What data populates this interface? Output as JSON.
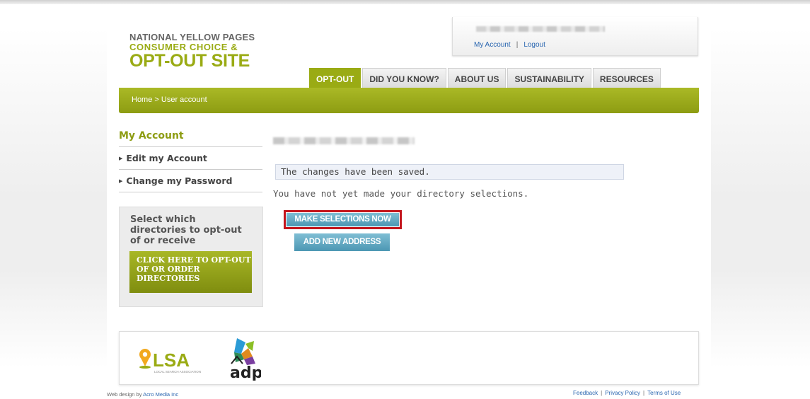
{
  "logo": {
    "line1": "NATIONAL YELLOW PAGES",
    "line2": "CONSUMER CHOICE &",
    "line3": "OPT-OUT SITE"
  },
  "account_bar": {
    "my_account": "My Account",
    "logout": "Logout"
  },
  "tabs": [
    "OPT-OUT",
    "DID YOU KNOW?",
    "ABOUT US",
    "SUSTAINABILITY",
    "RESOURCES"
  ],
  "breadcrumb": "Home > User account",
  "sidebar": {
    "title": "My Account",
    "items": [
      "Edit my Account",
      "Change my Password"
    ],
    "promo_text": "Select which directories to opt-out of or receive",
    "promo_button": "CLICK HERE TO OPT-OUT OF OR ORDER DIRECTORIES"
  },
  "main": {
    "status_message": "The changes have been saved.",
    "note": "You have not yet made your directory selections.",
    "make_selections_button": "MAKE SELECTIONS NOW",
    "add_address_button": "ADD NEW ADDRESS"
  },
  "footer": {
    "lsa_text": "LSA",
    "lsa_sub": "LOCAL SEARCH ASSOCIATION",
    "adp_text": "adp",
    "credit_prefix": "Web design by",
    "credit_link": "Acro Media Inc",
    "links": [
      "Feedback",
      "Privacy Policy",
      "Terms of Use"
    ]
  },
  "colors": {
    "brand_green": "#9aab14",
    "button_blue": "#5aa3bf",
    "highlight_red": "#c3151c"
  }
}
